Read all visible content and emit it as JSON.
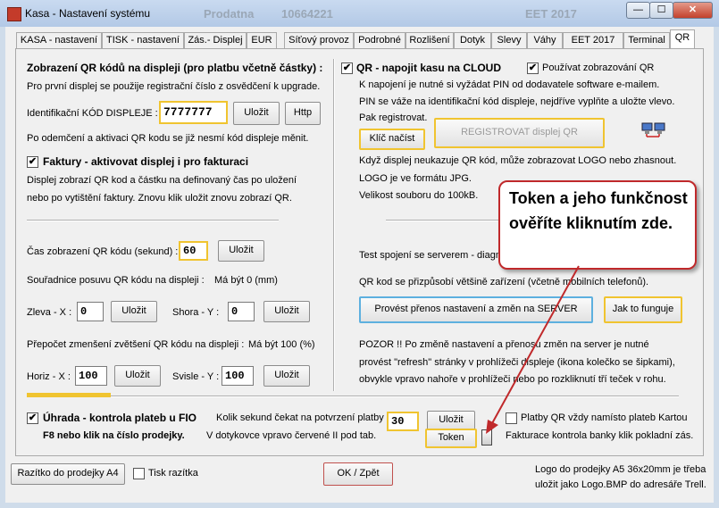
{
  "window": {
    "title": "Kasa - Nastavení systému",
    "ghost_left": "Prodatna",
    "ghost_num": "10664221",
    "ghost_right": "EET 2017",
    "minimize": "—",
    "maximize": "☐",
    "close": "✕"
  },
  "tabs": [
    "KASA - nastavení",
    "TISK - nastavení",
    "Zás.- Displej",
    "EUR",
    "Síťový provoz",
    "Podrobné",
    "Rozlišení",
    "Dotyk",
    "Slevy",
    "Váhy",
    "EET 2017",
    "Terminal",
    "QR"
  ],
  "left": {
    "heading": "Zobrazení QR kódů na displeji (pro platbu včetně částky) :",
    "info1": "Pro první displej se použije registrační číslo z osvědčení k upgrade.",
    "id_label": "Identifikační KÓD DISPLEJE :",
    "id_value": "7777777",
    "save": "Uložit",
    "http": "Http",
    "info2": "Po odemčení a aktivaci QR kodu se již nesmí kód displeje měnit.",
    "invoice_check": "✔",
    "invoice_label": "Faktury - aktivovat displej i pro fakturaci",
    "invoice_info1": "Displej zobrazí QR kod a částku na definovaný čas po uložení",
    "invoice_info2": "nebo po vytištění faktury. Znovu klik uložit znovu zobrazí QR.",
    "time_label": "Čas zobrazení QR kódu (sekund) :",
    "time_value": "60",
    "shift_label": "Souřadnice posuvu QR kódu na displeji :",
    "shift_note": "Má být 0 (mm)",
    "left_x_label": "Zleva - X :",
    "left_x_value": "0",
    "top_y_label": "Shora - Y :",
    "top_y_value": "0",
    "scale_label": "Přepočet zmenšení zvětšení QR kódu na displeji :",
    "scale_note": "Má být 100 (%)",
    "horiz_label": "Horiz - X :",
    "horiz_value": "100",
    "vert_label": "Svisle - Y :",
    "vert_value": "100"
  },
  "right": {
    "cloud_check": "✔",
    "cloud_label": "QR - napojit kasu na CLOUD",
    "use_display_check": "✔",
    "use_display_label": "Používat zobrazování QR",
    "info1": "K napojení je nutné si vyžádat PIN od dodavatele software e-mailem.",
    "info2": "PIN se váže na identifikační kód displeje, nejdříve vyplňte a uložte vlevo.",
    "info3": "Pak registrovat.",
    "key_button": "Klíč načíst",
    "register_button": "REGISTROVAT displej QR",
    "logo1": "Když displej neukazuje QR kód, může zobrazovat LOGO nebo zhasnout.",
    "logo2": "LOGO je ve formátu JPG.",
    "logo3": "Velikost souboru do 100kB.",
    "test": "Test spojení se serverem - diagno",
    "adapt": "QR kod se přizpůsobí většině zařízení (včetně mobilních telefonů).",
    "transfer_button": "Provést přenos nastavení a změn na SERVER",
    "howto_button": "Jak to funguje",
    "warn1": "POZOR !!   Po změně nastavení a přenosu změn na server je nutné",
    "warn2": "provést \"refresh\" stránky v prohlížeči displeje (ikona kolečko se šipkami),",
    "warn3": "obvykle vpravo nahoře v prohlížeči nebo po rozkliknutí tří teček v rohu."
  },
  "bottom": {
    "payment_check": "✔",
    "payment_label": "Úhrada - kontrola plateb u FIO",
    "f8_label": "F8 nebo klik na číslo prodejky.",
    "wait_label": "Kolik sekund čekat na potvrzení platby",
    "wait_value": "30",
    "save": "Uložit",
    "token": "Token",
    "touch_label": "V dotykovce vpravo červené  II  pod tab.",
    "qr_always_check": "",
    "qr_always_label": "Platby QR vždy namísto plateb Kartou",
    "bank_control": "Fakturace kontrola banky klik pokladní zás."
  },
  "footer": {
    "stamp_button": "Razítko do prodejky A4",
    "stamp_check": "",
    "stamp_label": "Tisk razítka",
    "ok_button": "OK / Zpět",
    "logo_note1": "Logo do prodejky A5 36x20mm je třeba",
    "logo_note2": "uložit jako Logo.BMP do adresáře Trell."
  },
  "callout": {
    "text": "Token a jeho funkčnost ověříte kliknutím zde."
  },
  "colors": {
    "highlight_yellow": "#f0c430",
    "highlight_blue": "#5db0df",
    "callout_red": "#c0292b"
  }
}
